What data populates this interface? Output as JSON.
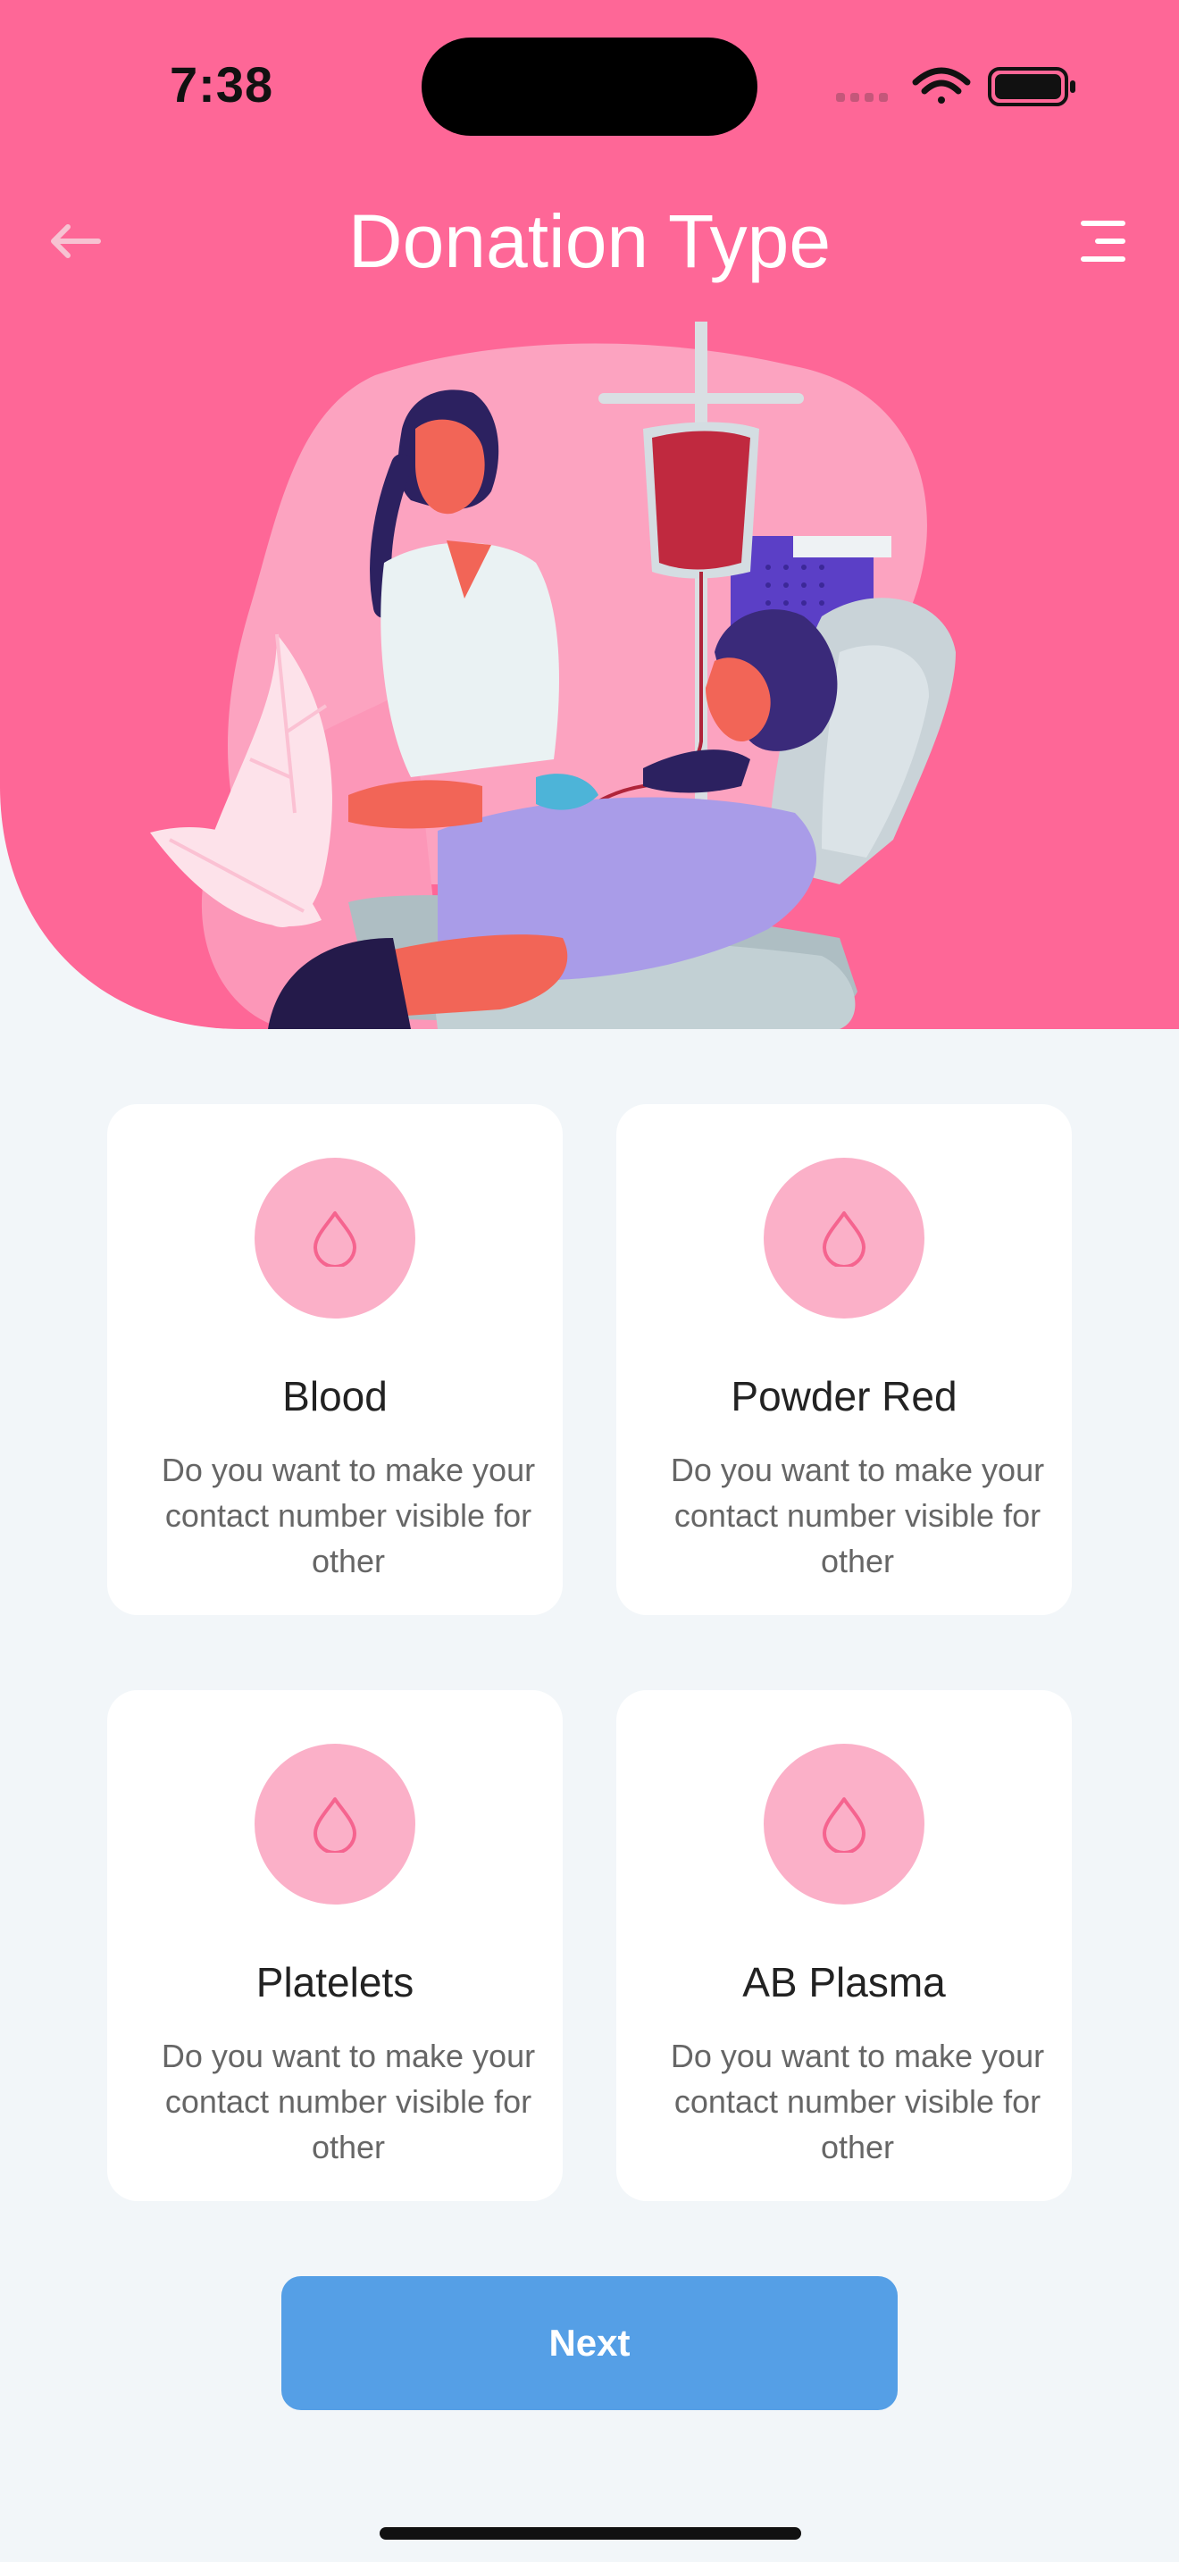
{
  "status_bar": {
    "time": "7:38"
  },
  "header": {
    "title": "Donation Type"
  },
  "colors": {
    "brand_pink": "#fe6797",
    "accent_blue": "#559fe6",
    "icon_bg": "#fbb0c8"
  },
  "icons": {
    "back": "arrow-left-icon",
    "menu": "menu-icon",
    "card": "drop-icon"
  },
  "donation_types": [
    {
      "title": "Blood",
      "description": "Do you want to make your contact number visible for other"
    },
    {
      "title": "Powder Red",
      "description": "Do you want to make your contact number visible for other"
    },
    {
      "title": "Platelets",
      "description": "Do you want to make your contact number visible for other"
    },
    {
      "title": "AB Plasma",
      "description": "Do you want to make your contact number visible for other"
    }
  ],
  "actions": {
    "next_label": "Next"
  }
}
